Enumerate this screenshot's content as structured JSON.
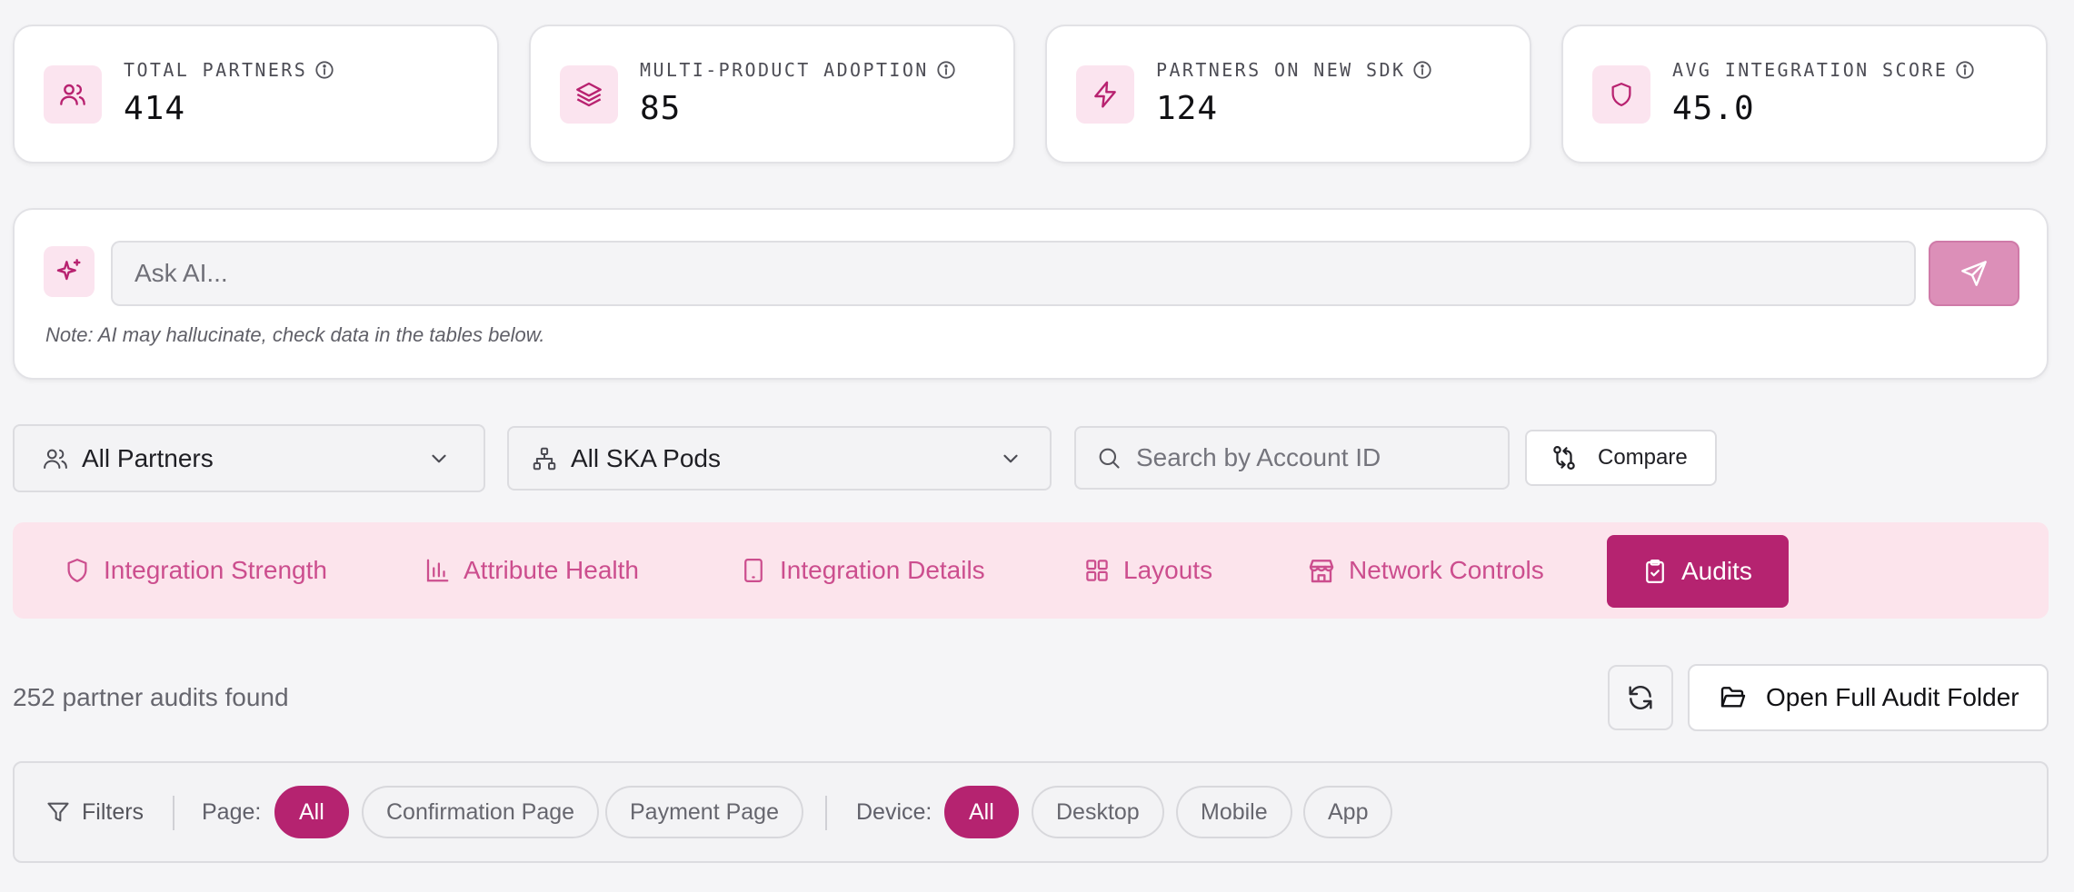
{
  "stats": [
    {
      "label": "TOTAL PARTNERS",
      "value": "414",
      "icon": "users-icon"
    },
    {
      "label": "MULTI-PRODUCT ADOPTION",
      "value": "85",
      "icon": "layers-icon"
    },
    {
      "label": "PARTNERS ON NEW SDK",
      "value": "124",
      "icon": "zap-icon"
    },
    {
      "label": "AVG INTEGRATION SCORE",
      "value": "45.0",
      "icon": "shield-icon"
    }
  ],
  "ai": {
    "placeholder": "Ask AI...",
    "note": "Note: AI may hallucinate, check data in the tables below."
  },
  "filters": {
    "partners_select": "All Partners",
    "pods_select": "All SKA Pods",
    "search_placeholder": "Search by Account ID",
    "compare_label": "Compare"
  },
  "tabs": [
    {
      "label": "Integration Strength",
      "icon": "shield-icon",
      "active": false
    },
    {
      "label": "Attribute Health",
      "icon": "bar-chart-icon",
      "active": false
    },
    {
      "label": "Integration Details",
      "icon": "tablet-icon",
      "active": false
    },
    {
      "label": "Layouts",
      "icon": "grid-icon",
      "active": false
    },
    {
      "label": "Network Controls",
      "icon": "store-icon",
      "active": false
    },
    {
      "label": "Audits",
      "icon": "clipboard-check-icon",
      "active": true
    }
  ],
  "results": {
    "count_text": "252 partner audits found",
    "open_folder_label": "Open Full Audit Folder"
  },
  "chipbar": {
    "filters_label": "Filters",
    "page_label": "Page:",
    "page_chips": [
      "All",
      "Confirmation Page",
      "Payment Page"
    ],
    "device_label": "Device:",
    "device_chips": [
      "All",
      "Desktop",
      "Mobile",
      "App"
    ]
  },
  "colors": {
    "accent": "#b52370",
    "accent_light": "#fbe4ef",
    "tab_bg": "#fce4ec",
    "tab_text": "#cc4e8e",
    "send_button": "#dc8fb8"
  }
}
